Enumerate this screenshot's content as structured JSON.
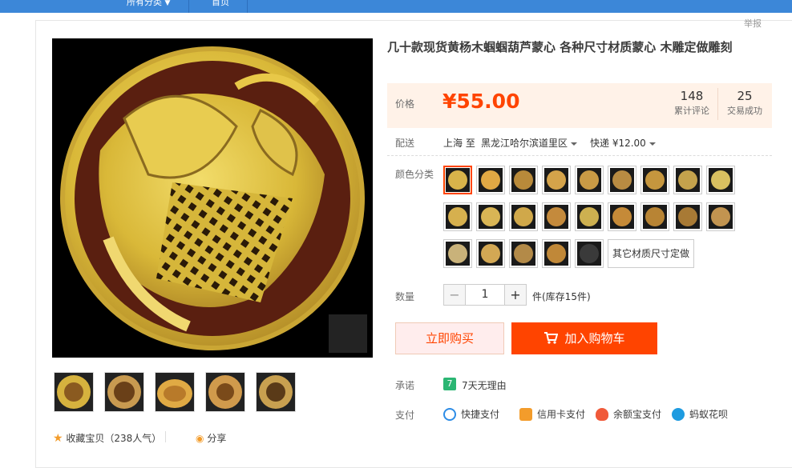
{
  "topnav": {
    "all_categories": "所有分类",
    "home": "首页"
  },
  "report_link": "举报",
  "product": {
    "title": "几十款现货黄杨木蝈蝈葫芦蒙心 各种尺寸材质蒙心 木雕定做雕刻",
    "price_label": "价格",
    "price": "¥55.00",
    "reviews_count": "148",
    "reviews_label": "累计评论",
    "sales_count": "25",
    "sales_label": "交易成功"
  },
  "shipping": {
    "label": "配送",
    "from": "上海",
    "to_word": "至",
    "destination": "黑龙江哈尔滨道里区",
    "method": "快递 ¥12.00"
  },
  "color": {
    "label": "颜色分类",
    "other_option": "其它材质尺寸定做",
    "swatch_colors": [
      "#d8b34a",
      "#e0a844",
      "#b88a3a",
      "#d4a34a",
      "#c99a45",
      "#b88b42",
      "#c5963e",
      "#c4a24c",
      "#d9c060",
      "#d6b04e",
      "#d9b555",
      "#d0a84a",
      "#c48a3c",
      "#cdb050",
      "#c58a38",
      "#b88434",
      "#a87a35",
      "#c29450",
      "#c9b27a",
      "#d3a854",
      "#b38a48",
      "#c08838",
      "#3a3a3a"
    ]
  },
  "quantity": {
    "label": "数量",
    "minus": "−",
    "value": "1",
    "plus": "+",
    "stock": "件(库存15件)"
  },
  "buttons": {
    "buy_now": "立即购买",
    "add_to_cart": "加入购物车"
  },
  "promise": {
    "label": "承诺",
    "badge": "7",
    "text": "7天无理由"
  },
  "payment": {
    "label": "支付",
    "methods": [
      "快捷支付",
      "信用卡支付",
      "余额宝支付",
      "蚂蚁花呗"
    ],
    "colors": [
      "#2d8ce6",
      "#f39c2b",
      "#f05a3a",
      "#1e9be0"
    ]
  },
  "favorites": {
    "text": "收藏宝贝（238人气）",
    "share": "分享"
  }
}
